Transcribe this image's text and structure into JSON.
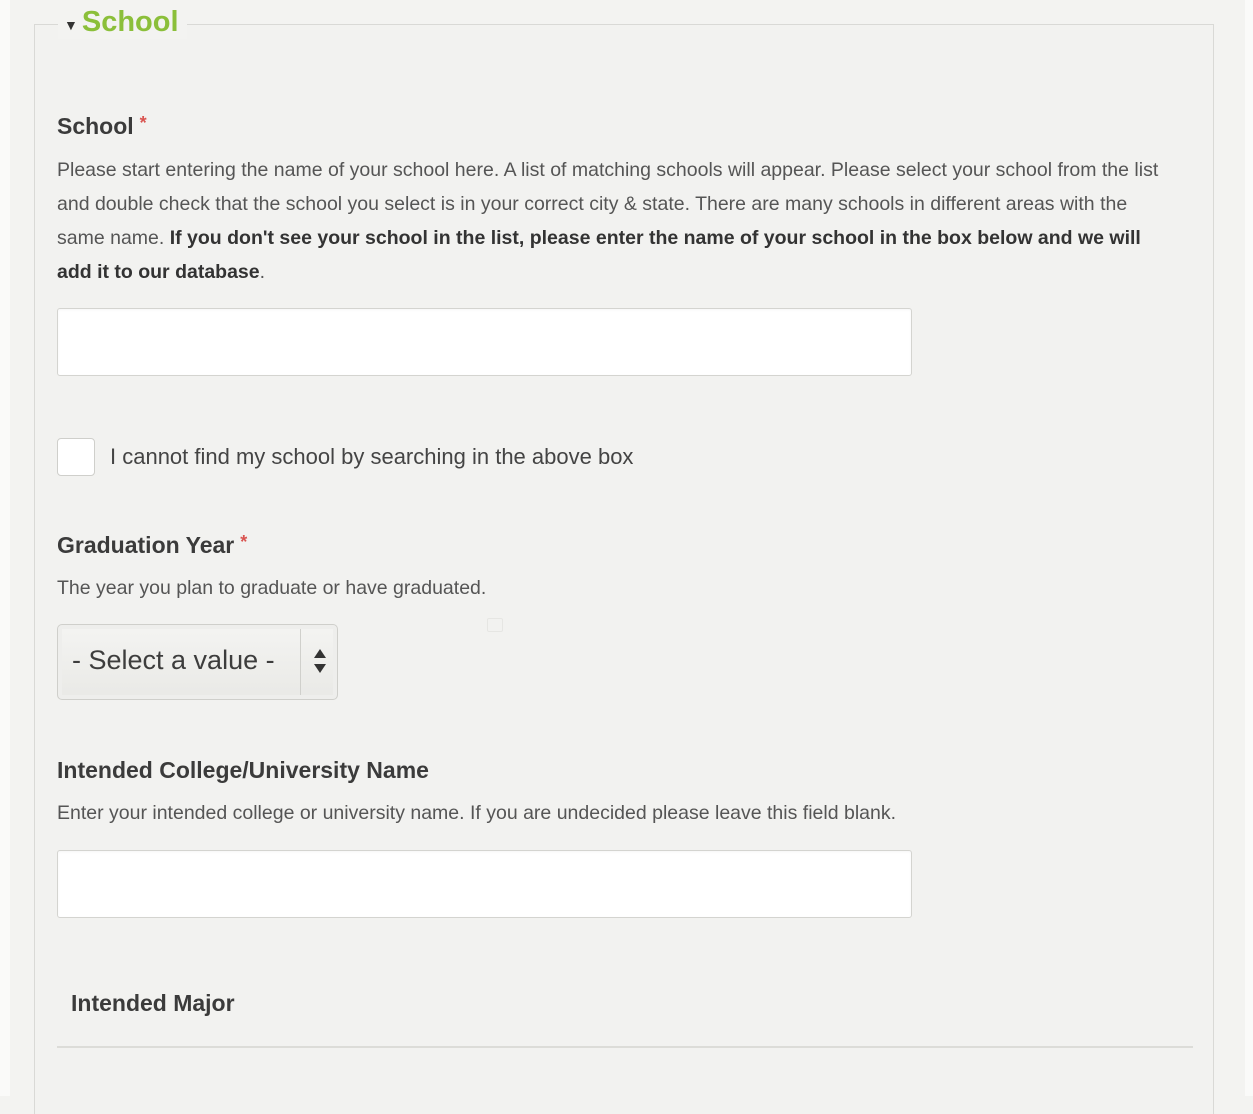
{
  "section": {
    "legend": "School"
  },
  "school_field": {
    "label": "School",
    "required_mark": "*",
    "description": "Please start entering the name of your school here. A list of matching schools will appear. Please select your school from the list and double check that the school you select is in your correct city & state. There are many schools in different areas with the same name. ",
    "description_bold": "If you don't see your school in the list, please enter the name of your school in the box below and we will add it to our database",
    "description_end": ".",
    "value": ""
  },
  "cannot_find": {
    "label": "I cannot find my school by searching in the above box",
    "checked": false
  },
  "graduation_year": {
    "label": "Graduation Year",
    "required_mark": "*",
    "description": "The year you plan to graduate or have graduated.",
    "selected": "- Select a value -"
  },
  "intended_college": {
    "label": "Intended College/University Name",
    "description": "Enter your intended college or university name. If you are undecided please leave this field blank.",
    "value": ""
  },
  "intended_major": {
    "label": "Intended Major"
  },
  "colors": {
    "legend": "#8bbf3a",
    "required": "#d9534f",
    "background": "#f3f3f1"
  },
  "icons": {
    "legend_toggle": "triangle-down-icon",
    "select_arrows": "up-down-arrows-icon"
  }
}
